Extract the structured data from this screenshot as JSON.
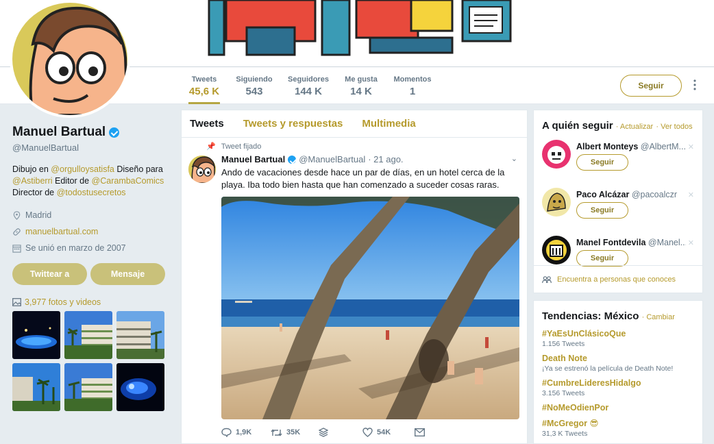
{
  "profile": {
    "name": "Manuel Bartual",
    "handle": "@ManuelBartual",
    "bio": {
      "p1": "Dibujo en ",
      "l1": "@orgulloysatisfa",
      "p2": " Diseño para ",
      "l2": "@Astiberri",
      "p3": " Editor de ",
      "l3": "@CarambaComics",
      "p4": "Director de ",
      "l4": "@todostusecretos"
    },
    "location": "Madrid",
    "website": "manuelbartual.com",
    "joined": "Se unió en marzo de 2007",
    "tweet_to_label": "Twittear a",
    "message_label": "Mensaje",
    "media_label": "3,977 fotos y videos"
  },
  "nav": {
    "stats": [
      {
        "label": "Tweets",
        "value": "45,6 K"
      },
      {
        "label": "Siguiendo",
        "value": "543"
      },
      {
        "label": "Seguidores",
        "value": "144 K"
      },
      {
        "label": "Me gusta",
        "value": "14 K"
      },
      {
        "label": "Momentos",
        "value": "1"
      }
    ],
    "follow_label": "Seguir"
  },
  "timeline": {
    "tabs": [
      "Tweets",
      "Tweets y respuestas",
      "Multimedia"
    ],
    "tweet": {
      "pinned_label": "Tweet fijado",
      "name": "Manuel Bartual",
      "handle": "@ManuelBartual",
      "date": "· 21 ago.",
      "text": "Ando de vacaciones desde hace un par de días, en un hotel cerca de la playa. Iba todo bien hasta que han comenzado a suceder cosas raras.",
      "replies": "1,9K",
      "retweets": "35K",
      "likes": "54K"
    }
  },
  "who_to_follow": {
    "title": "A quién seguir",
    "refresh": "· Actualizar",
    "view_all": "· Ver todos",
    "users": [
      {
        "name": "Albert Monteys",
        "handle": "@AlbertM...",
        "follow": "Seguir"
      },
      {
        "name": "Paco Alcázar",
        "handle": "@pacoalczr",
        "follow": "Seguir"
      },
      {
        "name": "Manel Fontdevila",
        "handle": "@Manel...",
        "follow": "Seguir"
      }
    ],
    "find_people": "Encuentra a personas que conoces"
  },
  "trends": {
    "title": "Tendencias: México",
    "change": "· Cambiar",
    "items": [
      {
        "name": "#YaEsUnClásicoQue",
        "meta": "1.156 Tweets"
      },
      {
        "name": "Death Note",
        "meta": "¡Ya se estrenó la película de Death Note!"
      },
      {
        "name": "#CumbreLideresHidalgo",
        "meta": "3.156 Tweets"
      },
      {
        "name": "#NoMeOdienPor",
        "meta": ""
      },
      {
        "name": "#McGregor 😎",
        "meta": "31,3 K Tweets"
      }
    ]
  },
  "colors": {
    "accent": "#b59a2c",
    "button_fill": "#c9c17a",
    "verified": "#1da1f2"
  }
}
